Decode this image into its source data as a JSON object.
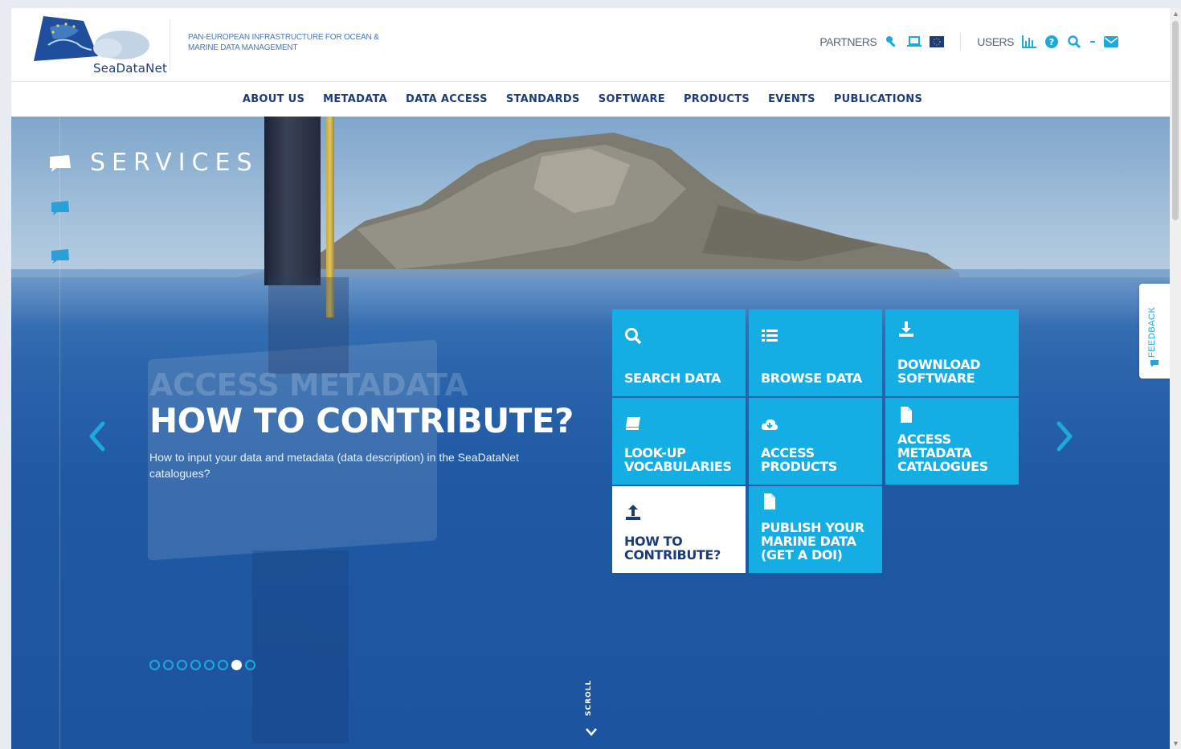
{
  "header": {
    "logo_text": "SeaDataNet",
    "tagline": "PAN-EUROPEAN INFRASTRUCTURE FOR OCEAN & MARINE DATA MANAGEMENT",
    "partners_label": "PARTNERS",
    "users_label": "USERS",
    "partner_icons": [
      "key-icon",
      "laptop-icon",
      "eu-flag-icon"
    ],
    "user_icons": [
      "bar-chart-icon",
      "help-icon",
      "search-icon",
      "dropdown-caret-icon",
      "envelope-icon"
    ]
  },
  "nav": {
    "items": [
      "ABOUT US",
      "METADATA",
      "DATA ACCESS",
      "STANDARDS",
      "SOFTWARE",
      "PRODUCTS",
      "EVENTS",
      "PUBLICATIONS"
    ]
  },
  "hero": {
    "section_label": "SERVICES",
    "ghost_title": "ACCESS METADATA",
    "slide_title": "HOW TO CONTRIBUTE?",
    "slide_description": "How to input your data and metadata (data description) in the SeaDataNet catalogues?",
    "slide_dots_total": 8,
    "slide_dots_active_index": 6,
    "scroll_label": "SCROLL"
  },
  "tiles": [
    {
      "label": "SEARCH DATA",
      "icon": "search-icon"
    },
    {
      "label": "BROWSE DATA",
      "icon": "list-icon"
    },
    {
      "label": "DOWNLOAD SOFTWARE",
      "icon": "download-icon"
    },
    {
      "label": "LOOK-UP VOCABULARIES",
      "icon": "book-icon"
    },
    {
      "label": "ACCESS PRODUCTS",
      "icon": "cloud-download-icon"
    },
    {
      "label": "ACCESS METADATA CATALOGUES",
      "icon": "file-icon"
    },
    {
      "label": "HOW TO CONTRIBUTE?",
      "icon": "upload-icon",
      "active": true
    },
    {
      "label": "PUBLISH YOUR MARINE DATA (GET A DOI)",
      "icon": "file-icon"
    }
  ],
  "feedback": {
    "label": "FEEDBACK"
  },
  "colors": {
    "brand_navy": "#1c3b7a",
    "accent_cyan": "#14aee4",
    "sea_blue": "#1f58a3"
  }
}
